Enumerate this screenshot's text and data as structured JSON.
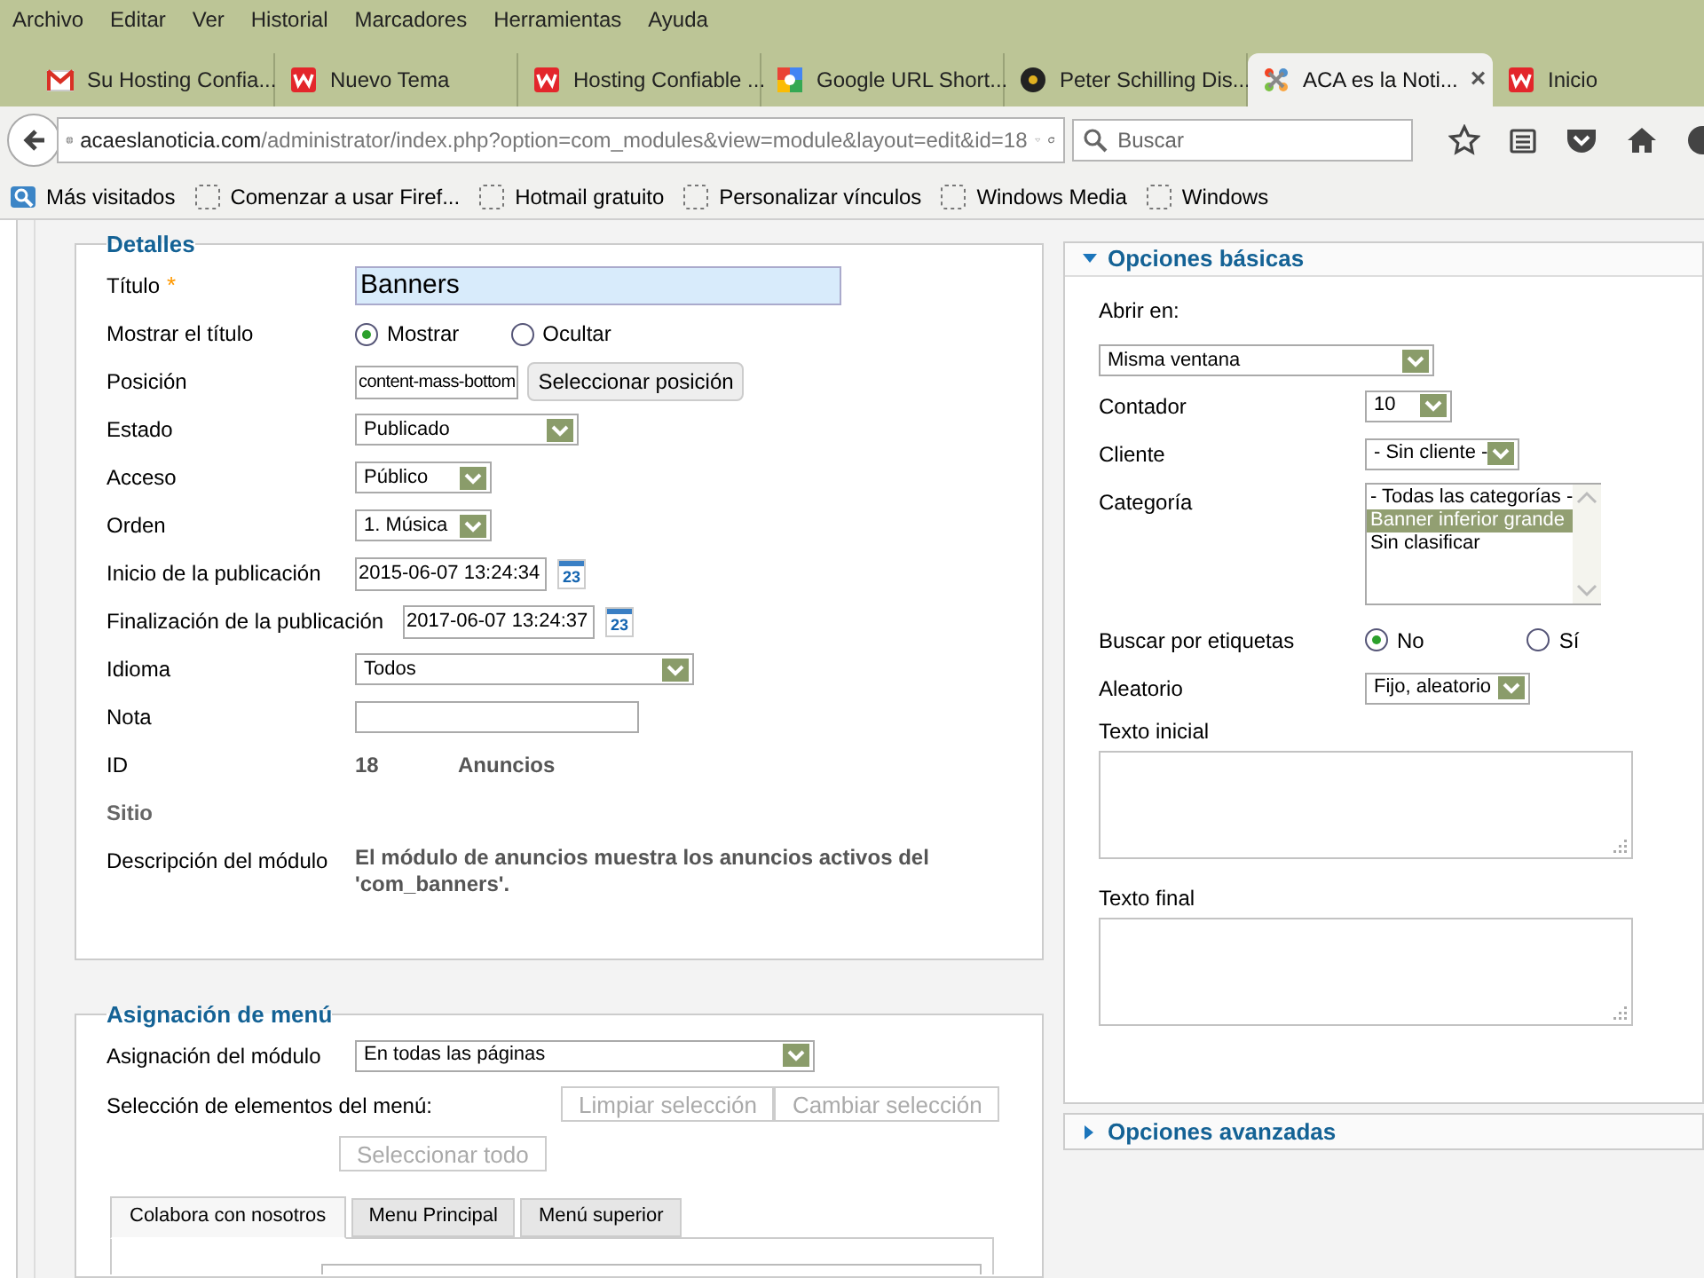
{
  "menu": [
    "Archivo",
    "Editar",
    "Ver",
    "Historial",
    "Marcadores",
    "Herramientas",
    "Ayuda"
  ],
  "tabs": [
    {
      "title": "Su Hosting Confia...",
      "kind": "mail",
      "selected": false
    },
    {
      "title": "Nuevo Tema",
      "kind": "brand",
      "selected": false
    },
    {
      "title": "Hosting Confiable ...",
      "kind": "brand",
      "selected": false
    },
    {
      "title": "Google URL Short...",
      "kind": "search",
      "selected": false
    },
    {
      "title": "Peter Schilling Dis...",
      "kind": "disc",
      "selected": false
    },
    {
      "title": "ACA es la Noti...",
      "kind": "cms",
      "selected": true,
      "close": "×"
    },
    {
      "title": "Inicio",
      "kind": "brand",
      "selected": false
    }
  ],
  "address": {
    "host": "acaeslanoticia.com",
    "path": "/administrator/index.php?option=com_modules&view=module&layout=edit&id=18"
  },
  "search": {
    "placeholder": "Buscar"
  },
  "bookmarks": [
    {
      "label": "Más visitados",
      "kind": "folder"
    },
    {
      "label": "Comenzar a usar Firef...",
      "kind": "page"
    },
    {
      "label": "Hotmail gratuito",
      "kind": "page"
    },
    {
      "label": "Personalizar vínculos",
      "kind": "page"
    },
    {
      "label": "Windows Media",
      "kind": "page"
    },
    {
      "label": "Windows",
      "kind": "page"
    }
  ],
  "details": {
    "legend": "Detalles",
    "fields": [
      {
        "kind": "text",
        "label": "Título",
        "required_mark": "*",
        "value": "Banners"
      },
      {
        "kind": "radio",
        "label": "Mostrar el título",
        "options": [
          {
            "label": "Mostrar",
            "selected": true
          },
          {
            "label": "Ocultar",
            "selected": false
          }
        ]
      },
      {
        "kind": "position",
        "label": "Posición",
        "value": "content-mass-bottom",
        "button": "Seleccionar posición"
      },
      {
        "kind": "select",
        "label": "Estado",
        "value": "Publicado"
      },
      {
        "kind": "select",
        "label": "Acceso",
        "value": "Público"
      },
      {
        "kind": "select",
        "label": "Orden",
        "value": "1. Música"
      },
      {
        "kind": "date",
        "label": "Inicio de la publicación",
        "value": "2015-06-07 13:24:34",
        "calendar_day": "23"
      },
      {
        "kind": "date",
        "label": "Finalización de la publicación",
        "value": "2017-06-07 13:24:37",
        "calendar_day": "23"
      },
      {
        "kind": "select",
        "label": "Idioma",
        "value": "Todos"
      },
      {
        "kind": "text",
        "label": "Nota"
      },
      {
        "kind": "info",
        "label": "ID",
        "value": "18",
        "extra": "Anuncios"
      },
      {
        "kind": "heading",
        "label": "Sitio"
      },
      {
        "kind": "description",
        "label": "Descripción del módulo",
        "value": "El módulo de anuncios muestra los anuncios activos del 'com_banners'."
      }
    ]
  },
  "menu_assignment": {
    "legend": "Asignación de menú",
    "label": "Asignación del módulo",
    "value": "En todas las páginas",
    "selection_label": "Selección de elementos del menú:",
    "buttons": [
      "Limpiar selección",
      "Cambiar selección",
      "Seleccionar todo"
    ],
    "tabs": [
      {
        "label": "Colabora con nosotros",
        "selected": true
      },
      {
        "label": "Menu Principal",
        "selected": false
      },
      {
        "label": "Menú superior",
        "selected": false
      }
    ]
  },
  "panels": [
    {
      "title": "Opciones básicas",
      "expanded": true,
      "fields": [
        {
          "kind": "select_below",
          "label": "Abrir en:",
          "value": "Misma ventana"
        },
        {
          "kind": "select",
          "label": "Contador",
          "value": "10"
        },
        {
          "kind": "select",
          "label": "Cliente",
          "value": "- Sin cliente -"
        },
        {
          "kind": "list",
          "label": "Categoría",
          "options": [
            {
              "label": "- Todas las categorías -",
              "selected": false
            },
            {
              "label": "Banner inferior grande",
              "selected": true
            },
            {
              "label": "Sin clasificar",
              "selected": false
            }
          ]
        },
        {
          "kind": "radio",
          "label": "Buscar por etiquetas",
          "options": [
            {
              "label": "No",
              "selected": true
            },
            {
              "label": "Sí",
              "selected": false
            }
          ]
        },
        {
          "kind": "select",
          "label": "Aleatorio",
          "value": "Fijo, aleatorio"
        },
        {
          "kind": "textarea",
          "label": "Texto inicial"
        },
        {
          "kind": "textarea",
          "label": "Texto final"
        }
      ]
    },
    {
      "title": "Opciones avanzadas",
      "expanded": false
    }
  ]
}
